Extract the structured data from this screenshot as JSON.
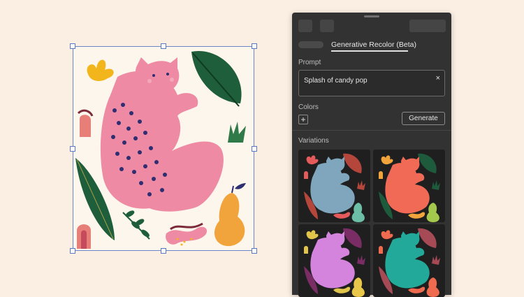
{
  "panel": {
    "tab_title": "Generative Recolor (Beta)",
    "prompt_label": "Prompt",
    "prompt_value": "Splash of candy pop",
    "clear_glyph": "×",
    "colors_label": "Colors",
    "add_color_glyph": "+",
    "generate_label": "Generate",
    "variations_label": "Variations"
  },
  "colors": {
    "artboard_cat": "#ee8aa4",
    "spots": "#2e2e72",
    "leaf_dark": "#1f5e3a",
    "accent_yellow": "#f2b51c",
    "pear": "#f2a43c",
    "panel_bg": "#323232"
  },
  "variations": [
    {
      "cat": "#7fa6bd",
      "accent": "#e55a5a",
      "leaf": "#b5463b",
      "pear": "#6cbfa6"
    },
    {
      "cat": "#f06a56",
      "accent": "#f2a43c",
      "leaf": "#1e5a3c",
      "pear": "#a4c84b"
    },
    {
      "cat": "#d484dd",
      "accent": "#e1c44a",
      "leaf": "#7a2d65",
      "pear": "#e9c74a"
    },
    {
      "cat": "#23a99a",
      "accent": "#ef6b4f",
      "leaf": "#a64a56",
      "pear": "#ef6b4f"
    }
  ]
}
